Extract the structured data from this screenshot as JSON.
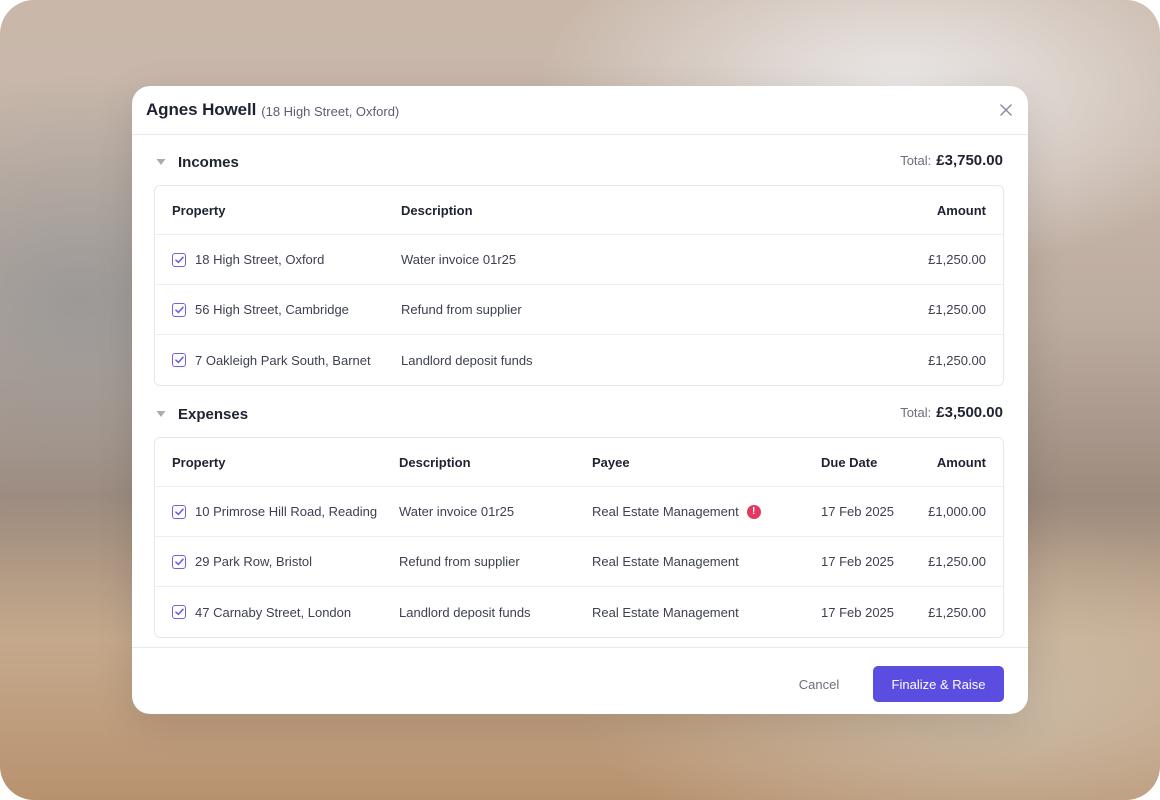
{
  "modal": {
    "title": "Agnes Howell",
    "subtitle": "(18 High Street, Oxford)",
    "close_icon": "close-icon"
  },
  "incomes": {
    "title": "Incomes",
    "total_label": "Total:",
    "total_value": "£3,750.00",
    "columns": {
      "property": "Property",
      "description": "Description",
      "amount": "Amount"
    },
    "rows": [
      {
        "checked": true,
        "property": "18 High Street, Oxford",
        "description": "Water invoice 01r25",
        "amount": "£1,250.00"
      },
      {
        "checked": true,
        "property": "56 High Street, Cambridge",
        "description": "Refund from supplier",
        "amount": "£1,250.00"
      },
      {
        "checked": true,
        "property": "7 Oakleigh Park South, Barnet",
        "description": "Landlord deposit funds",
        "amount": "£1,250.00"
      }
    ]
  },
  "expenses": {
    "title": "Expenses",
    "total_label": "Total:",
    "total_value": "£3,500.00",
    "columns": {
      "property": "Property",
      "description": "Description",
      "payee": "Payee",
      "due_date": "Due Date",
      "amount": "Amount"
    },
    "rows": [
      {
        "checked": true,
        "property": "10 Primrose Hill Road, Reading",
        "description": "Water invoice 01r25",
        "payee": "Real Estate Management",
        "warning": true,
        "warning_glyph": "!",
        "due_date": "17 Feb 2025",
        "amount": "£1,000.00"
      },
      {
        "checked": true,
        "property": "29 Park Row, Bristol",
        "description": "Refund from supplier",
        "payee": "Real Estate Management",
        "warning": false,
        "due_date": "17 Feb 2025",
        "amount": "£1,250.00"
      },
      {
        "checked": true,
        "property": "47 Carnaby Street, London",
        "description": "Landlord deposit funds",
        "payee": "Real Estate Management",
        "warning": false,
        "due_date": "17 Feb 2025",
        "amount": "£1,250.00"
      }
    ]
  },
  "footer": {
    "cancel_label": "Cancel",
    "primary_label": "Finalize & Raise"
  },
  "colors": {
    "accent": "#5b4de0",
    "checkbox": "#6c63e0",
    "warning": "#e5375f"
  }
}
